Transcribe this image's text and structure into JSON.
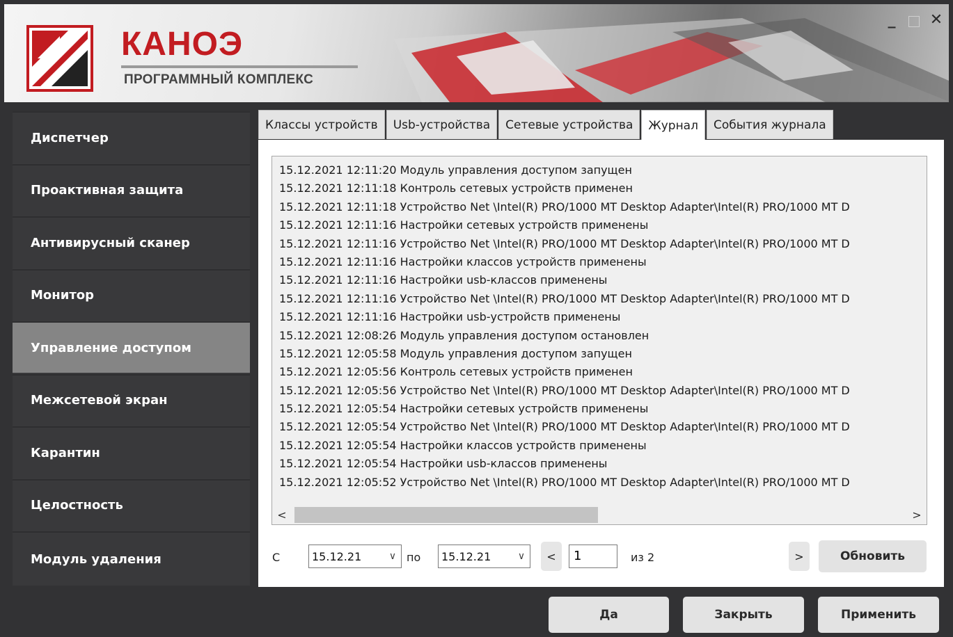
{
  "header": {
    "brand": "КАНОЭ",
    "subtitle": "ПРОГРАММНЫЙ КОМПЛЕКС",
    "minimize": "_",
    "close": "✕"
  },
  "sidebar": {
    "items": [
      {
        "label": "Диспетчер",
        "active": false
      },
      {
        "label": "Проактивная защита",
        "active": false
      },
      {
        "label": "Антивирусный сканер",
        "active": false
      },
      {
        "label": "Монитор",
        "active": false
      },
      {
        "label": "Управление доступом",
        "active": true
      },
      {
        "label": "Межсетевой экран",
        "active": false
      },
      {
        "label": "Карантин",
        "active": false
      },
      {
        "label": "Целостность",
        "active": false
      },
      {
        "label": "Модуль удаления",
        "active": false
      }
    ]
  },
  "tabs": [
    {
      "label": "Классы устройств",
      "active": false
    },
    {
      "label": "Usb-устройства",
      "active": false
    },
    {
      "label": "Сетевые устройства",
      "active": false
    },
    {
      "label": "Журнал",
      "active": true
    },
    {
      "label": "События журнала",
      "active": false
    }
  ],
  "log": {
    "entries": [
      "15.12.2021 12:11:20 Модуль управления доступом запущен",
      "15.12.2021 12:11:18 Контроль сетевых устройств применен",
      "15.12.2021 12:11:18 Устройство Net \\Intel(R) PRO/1000 MT Desktop Adapter\\Intel(R) PRO/1000 MT D",
      "15.12.2021 12:11:16 Настройки сетевых устройств применены",
      "15.12.2021 12:11:16 Устройство Net \\Intel(R) PRO/1000 MT Desktop Adapter\\Intel(R) PRO/1000 MT D",
      "15.12.2021 12:11:16 Настройки классов устройств применены",
      "15.12.2021 12:11:16 Настройки usb-классов применены",
      "15.12.2021 12:11:16 Устройство Net \\Intel(R) PRO/1000 MT Desktop Adapter\\Intel(R) PRO/1000 MT D",
      "15.12.2021 12:11:16 Настройки usb-устройств применены",
      "15.12.2021 12:08:26 Модуль управления доступом остановлен",
      "15.12.2021 12:05:58 Модуль управления доступом запущен",
      "15.12.2021 12:05:56 Контроль сетевых устройств применен",
      "15.12.2021 12:05:56 Устройство Net \\Intel(R) PRO/1000 MT Desktop Adapter\\Intel(R) PRO/1000 MT D",
      "15.12.2021 12:05:54 Настройки сетевых устройств применены",
      "15.12.2021 12:05:54 Устройство Net \\Intel(R) PRO/1000 MT Desktop Adapter\\Intel(R) PRO/1000 MT D",
      "15.12.2021 12:05:54 Настройки классов устройств применены",
      "15.12.2021 12:05:54 Настройки usb-классов применены",
      "15.12.2021 12:05:52 Устройство Net \\Intel(R) PRO/1000 MT Desktop Adapter\\Intel(R) PRO/1000 MT D"
    ],
    "scroll_left": "<",
    "scroll_right": ">"
  },
  "filter": {
    "from_label": "С",
    "from_date": "15.12.21",
    "to_label": "по",
    "to_date": "15.12.21",
    "prev": "<",
    "page": "1",
    "of_label": "из 2",
    "next": ">",
    "refresh": "Обновить"
  },
  "footer": {
    "ok": "Да",
    "close": "Закрыть",
    "apply": "Применить"
  }
}
